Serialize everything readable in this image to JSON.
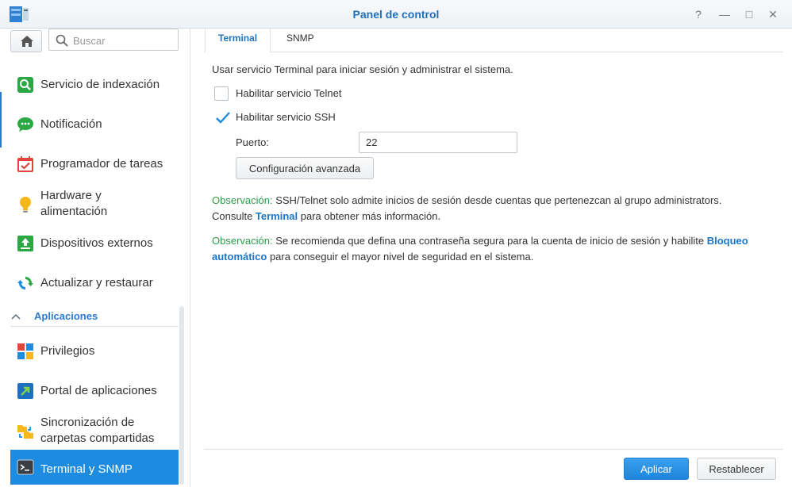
{
  "window": {
    "title": "Panel de control",
    "buttons": {
      "help": "?",
      "minimize": "—",
      "maximize": "□",
      "close": "✕"
    }
  },
  "sidebar": {
    "search_placeholder": "Buscar",
    "items_top": [
      {
        "label": "Servicio de indexación",
        "icon": "magnifier-icon"
      },
      {
        "label": "Notificación",
        "icon": "chat-bubble-icon"
      },
      {
        "label": "Programador de tareas",
        "icon": "calendar-check-icon"
      },
      {
        "label": "Hardware y",
        "label2": "alimentación",
        "icon": "lightbulb-icon"
      },
      {
        "label": "Dispositivos externos",
        "icon": "upload-device-icon"
      },
      {
        "label": "Actualizar y restaurar",
        "icon": "refresh-icon"
      }
    ],
    "section": "Aplicaciones",
    "items_apps": [
      {
        "label": "Privilegios",
        "icon": "privileges-icon"
      },
      {
        "label": "Portal de aplicaciones",
        "icon": "portal-icon"
      },
      {
        "label": "Sincronización de",
        "label2": "carpetas compartidas",
        "icon": "folder-sync-icon"
      },
      {
        "label": "Terminal y SNMP",
        "icon": "terminal-icon",
        "active": true
      }
    ]
  },
  "tabs": [
    {
      "label": "Terminal",
      "active": true
    },
    {
      "label": "SNMP",
      "active": false
    }
  ],
  "terminal": {
    "intro": "Usar servicio Terminal para iniciar sesión y administrar el sistema.",
    "telnet_label": "Habilitar servicio Telnet",
    "telnet_checked": false,
    "ssh_label": "Habilitar servicio SSH",
    "ssh_checked": true,
    "port_label": "Puerto:",
    "port_value": "22",
    "advanced_button": "Configuración avanzada",
    "note1_prefix": "Observación:",
    "note1_text": " SSH/Telnet solo admite inicios de sesión desde cuentas que pertenezcan al grupo administrators.",
    "note1_line2_a": "Consulte ",
    "note1_link": "Terminal",
    "note1_line2_b": " para obtener más información.",
    "note2_prefix": "Observación:",
    "note2_text": " Se recomienda que defina una contraseña segura para la cuenta de inicio de sesión y habilite ",
    "note2_link_a": "Bloqueo",
    "note2_link_b": "automático",
    "note2_tail": " para conseguir el mayor nivel de seguridad en el sistema."
  },
  "footer": {
    "apply": "Aplicar",
    "reset": "Restablecer"
  },
  "colors": {
    "accent": "#1d8ce0",
    "title": "#1f6fbf",
    "note": "#2a9d4a"
  }
}
